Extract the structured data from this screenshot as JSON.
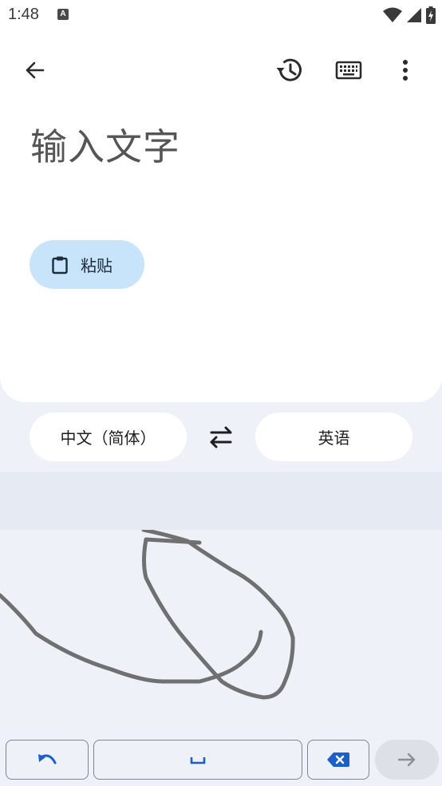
{
  "status_bar": {
    "time": "1:48",
    "notification_badge": "A",
    "icons": [
      "wifi-icon",
      "signal-icon",
      "battery-charging-icon"
    ]
  },
  "toolbar": {
    "back_icon": "arrow-left-icon",
    "history_icon": "history-icon",
    "keyboard_icon": "keyboard-icon",
    "more_icon": "more-vert-icon"
  },
  "input": {
    "placeholder": "输入文字"
  },
  "paste_button": {
    "label": "粘贴",
    "icon": "clipboard-icon"
  },
  "languages": {
    "source": "中文（简体）",
    "target": "英语",
    "swap_icon": "swap-arrows-icon"
  },
  "keyboard": {
    "undo_icon": "undo-icon",
    "space_icon": "space-bar-icon",
    "delete_icon": "backspace-icon",
    "go_icon": "arrow-right-icon"
  },
  "colors": {
    "accent": "#1a5fd0",
    "paste_bg": "#c7e4fb",
    "background": "#eef1f8",
    "ink": "#707070"
  }
}
